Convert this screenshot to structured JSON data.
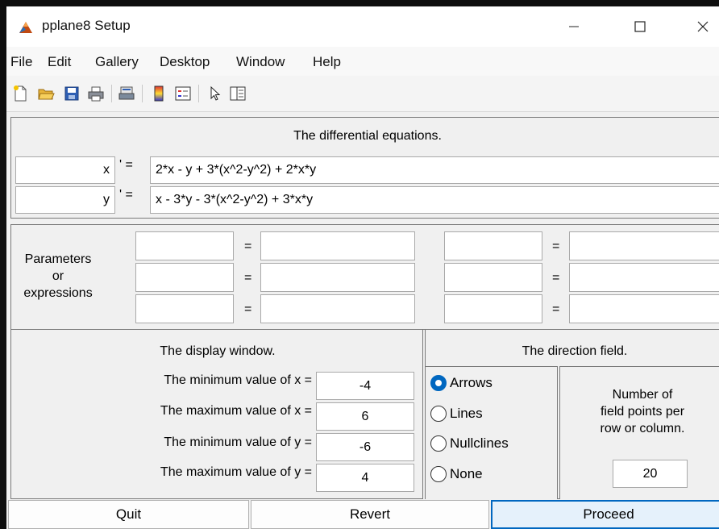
{
  "window": {
    "title": "pplane8 Setup"
  },
  "menu": [
    "File",
    "Edit",
    "Gallery",
    "Desktop",
    "Window",
    "Help"
  ],
  "toolbar_icons": [
    "new-file-icon",
    "open-folder-icon",
    "save-icon",
    "print-icon",
    "print-preview-icon",
    "colorbar-icon",
    "legend-icon",
    "pointer-icon",
    "property-inspector-icon"
  ],
  "equations": {
    "heading": "The differential equations.",
    "prime_symbol": "' =",
    "rows": [
      {
        "var": "x",
        "expr": "2*x - y + 3*(x^2-y^2) + 2*x*y"
      },
      {
        "var": "y",
        "expr": "x - 3*y - 3*(x^2-y^2) + 3*x*y"
      }
    ]
  },
  "parameters": {
    "label_line1": "Parameters",
    "label_line2": "or",
    "label_line3": "expressions",
    "equals": "=",
    "rows": [
      {
        "left_name": "",
        "left_value": "",
        "right_name": "",
        "right_value": ""
      },
      {
        "left_name": "",
        "left_value": "",
        "right_name": "",
        "right_value": ""
      },
      {
        "left_name": "",
        "left_value": "",
        "right_name": "",
        "right_value": ""
      }
    ]
  },
  "display_window": {
    "heading": "The display window.",
    "rows": [
      {
        "label": "The minimum value of x =",
        "value": "-4"
      },
      {
        "label": "The maximum value of x =",
        "value": "6"
      },
      {
        "label": "The minimum value of y =",
        "value": "-6"
      },
      {
        "label": "The maximum value of y =",
        "value": "4"
      }
    ]
  },
  "direction_field": {
    "heading": "The direction field.",
    "options": [
      {
        "label": "Arrows",
        "selected": true
      },
      {
        "label": "Lines",
        "selected": false
      },
      {
        "label": "Nullclines",
        "selected": false
      },
      {
        "label": "None",
        "selected": false
      }
    ],
    "points_label_line1": "Number of",
    "points_label_line2": "field points per",
    "points_label_line3": "row or column.",
    "points_value": "20"
  },
  "buttons": {
    "quit": "Quit",
    "revert": "Revert",
    "proceed": "Proceed"
  },
  "colors": {
    "accent": "#0067c0",
    "panel_bg": "#f0f0f0",
    "field_bg": "#ffffff"
  }
}
